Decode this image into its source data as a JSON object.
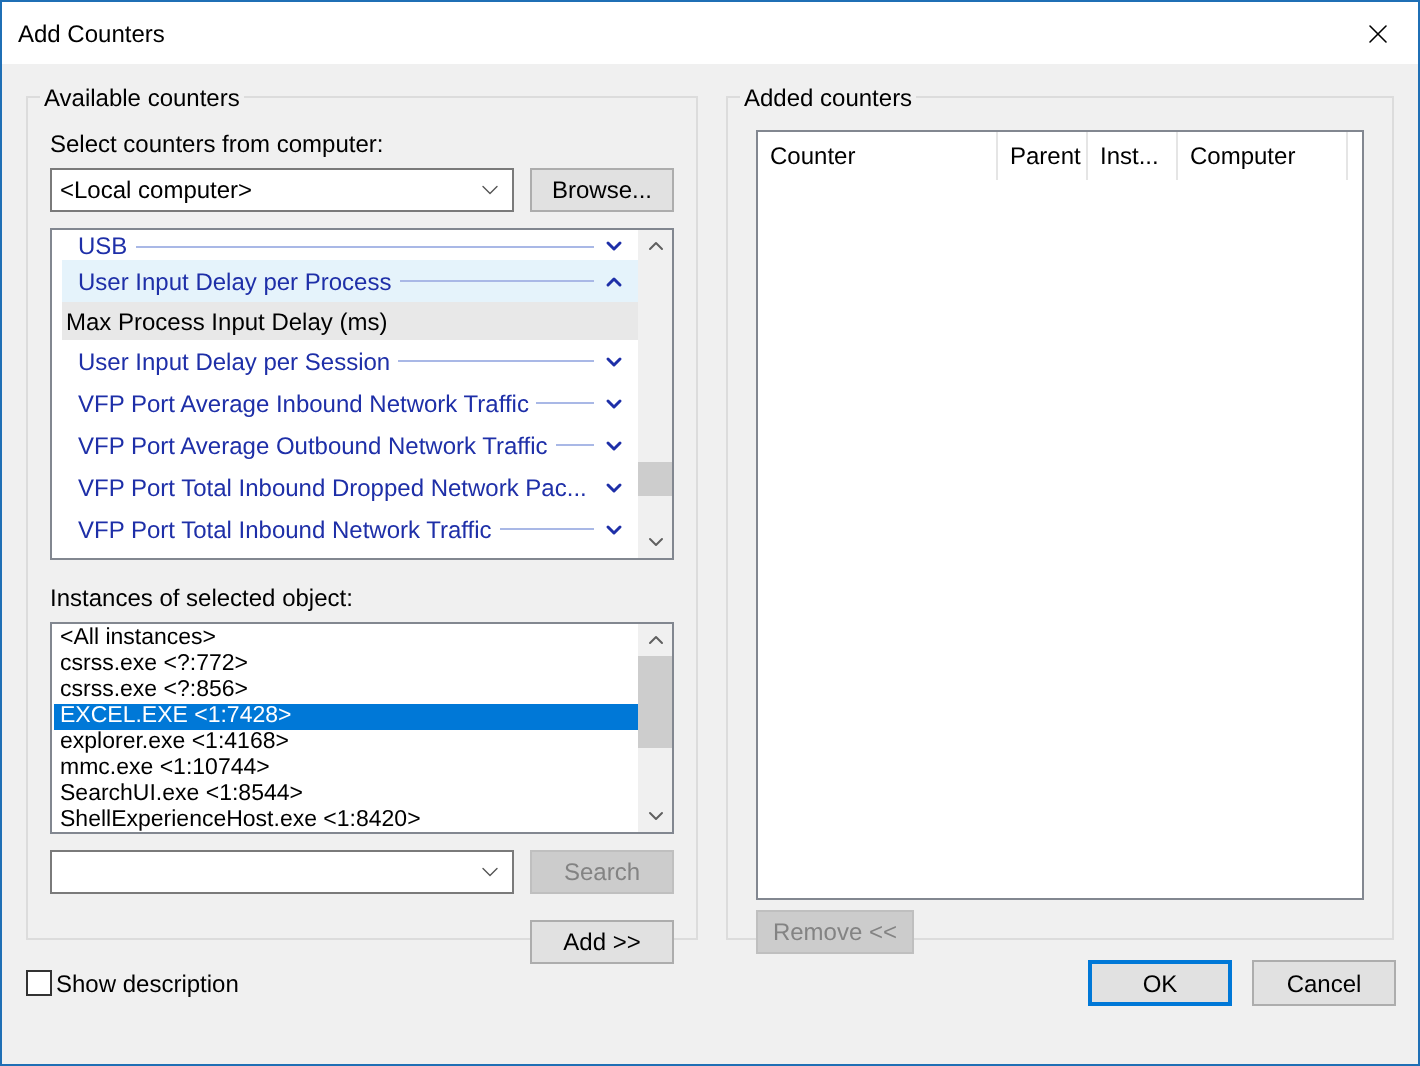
{
  "window": {
    "title": "Add Counters"
  },
  "available": {
    "title": "Available counters",
    "computer_label": "Select counters from computer:",
    "computer_value": "<Local computer>",
    "browse_button": "Browse...",
    "counters": [
      {
        "kind": "object",
        "label": "USB",
        "expanded": false,
        "selected": false
      },
      {
        "kind": "object",
        "label": "User Input Delay per Process",
        "expanded": true,
        "selected": true
      },
      {
        "kind": "counter",
        "label": "Max Process Input Delay (ms)",
        "selected": true
      },
      {
        "kind": "object",
        "label": "User Input Delay per Session",
        "expanded": false,
        "selected": false
      },
      {
        "kind": "object",
        "label": "VFP Port Average Inbound Network Traffic",
        "expanded": false,
        "selected": false
      },
      {
        "kind": "object",
        "label": "VFP Port Average Outbound Network Traffic",
        "expanded": false,
        "selected": false
      },
      {
        "kind": "object",
        "label": "VFP Port Total Inbound Dropped Network Pac...",
        "expanded": false,
        "selected": false
      },
      {
        "kind": "object",
        "label": "VFP Port Total Inbound Network Traffic",
        "expanded": false,
        "selected": false
      }
    ],
    "instances_label": "Instances of selected object:",
    "instances": [
      {
        "label": "<All instances>",
        "selected": false
      },
      {
        "label": "csrss.exe <?:772>",
        "selected": false
      },
      {
        "label": "csrss.exe <?:856>",
        "selected": false
      },
      {
        "label": "EXCEL.EXE <1:7428>",
        "selected": true
      },
      {
        "label": "explorer.exe <1:4168>",
        "selected": false
      },
      {
        "label": "mmc.exe <1:10744>",
        "selected": false
      },
      {
        "label": "SearchUI.exe <1:8544>",
        "selected": false
      },
      {
        "label": "ShellExperienceHost.exe <1:8420>",
        "selected": false
      }
    ],
    "search_button": {
      "label": "Search",
      "disabled": true
    },
    "add_button": {
      "label": "Add >>",
      "disabled": false
    }
  },
  "added": {
    "title": "Added counters",
    "columns": [
      "Counter",
      "Parent",
      "Inst...",
      "Computer"
    ],
    "remove_button": {
      "label": "Remove <<",
      "disabled": true
    }
  },
  "show_description": {
    "label": "Show description",
    "checked": false
  },
  "buttons": [
    {
      "label": "OK",
      "default": true
    },
    {
      "label": "Cancel",
      "default": false
    }
  ]
}
